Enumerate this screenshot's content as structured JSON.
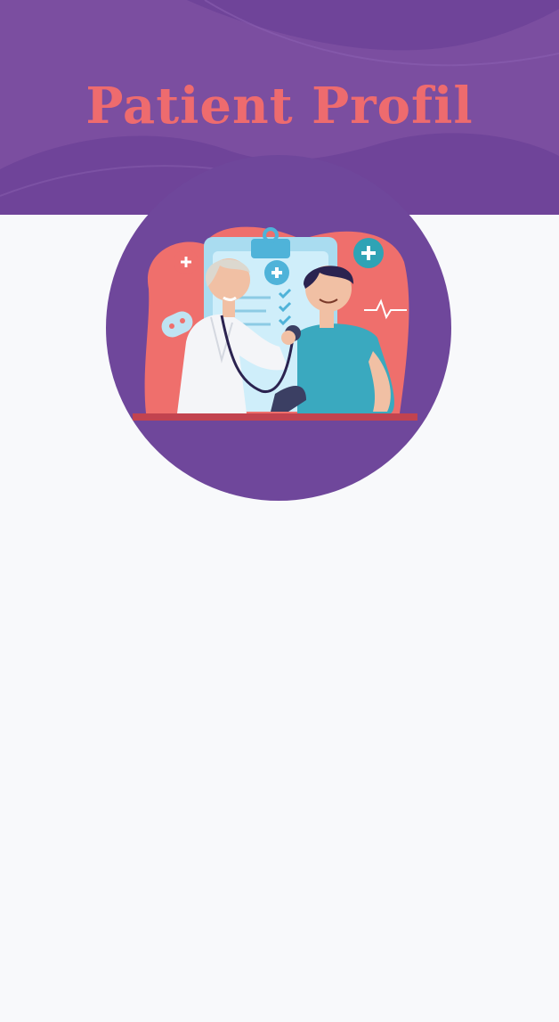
{
  "header": {
    "title": "Patient Profil"
  },
  "avatar": {
    "icon": "doctor-patient-checkup-illustration"
  },
  "colors": {
    "header_purple": "#7b4ea0",
    "header_wave": "#6f4499",
    "title_coral": "#ee6b6e",
    "avatar_bg": "#6f479b",
    "blob_coral": "#ef6f6c",
    "page_bg": "#f8f9fb"
  }
}
